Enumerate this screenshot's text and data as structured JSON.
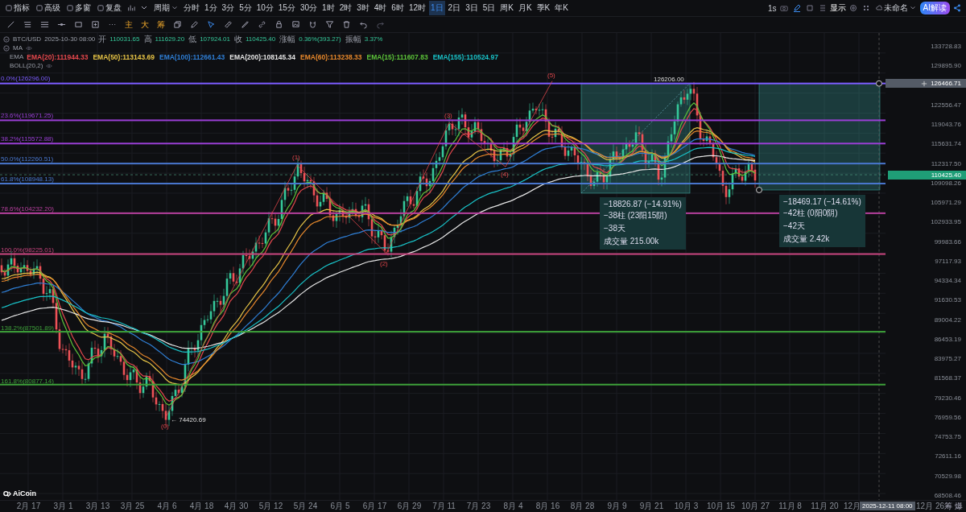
{
  "toolbar": {
    "menus": [
      {
        "label": "指标"
      },
      {
        "label": "高级"
      },
      {
        "label": "多窗"
      },
      {
        "label": "复盘"
      }
    ],
    "period_label": "周期",
    "intervals": [
      {
        "label": "分时",
        "selected": false
      },
      {
        "label": "1分",
        "selected": false
      },
      {
        "label": "3分",
        "selected": false
      },
      {
        "label": "5分",
        "selected": false
      },
      {
        "label": "10分",
        "selected": false
      },
      {
        "label": "15分",
        "selected": false
      },
      {
        "label": "30分",
        "selected": false
      },
      {
        "label": "1时",
        "selected": false
      },
      {
        "label": "2时",
        "selected": false
      },
      {
        "label": "3时",
        "selected": false
      },
      {
        "label": "4时",
        "selected": false
      },
      {
        "label": "6时",
        "selected": false
      },
      {
        "label": "12时",
        "selected": false
      },
      {
        "label": "1日",
        "selected": true
      },
      {
        "label": "2日",
        "selected": false
      },
      {
        "label": "3日",
        "selected": false
      },
      {
        "label": "5日",
        "selected": false
      },
      {
        "label": "周K",
        "selected": false
      },
      {
        "label": "月K",
        "selected": false
      },
      {
        "label": "季K",
        "selected": false
      },
      {
        "label": "年K",
        "selected": false
      }
    ],
    "refresh": "1s",
    "display": "显示",
    "layout_name": "未命名",
    "ai_button": "AI解读"
  },
  "draw_tools": {
    "text_tools": [
      "主",
      "大",
      "筹"
    ]
  },
  "legend": {
    "symbol": "BTC/USD",
    "time": "2025-10-30 08:00",
    "fields": [
      {
        "label": "开",
        "value": "110031.65"
      },
      {
        "label": "高",
        "value": "111629.20"
      },
      {
        "label": "低",
        "value": "107924.01"
      },
      {
        "label": "收",
        "value": "110425.40"
      },
      {
        "label": "涨幅",
        "value": "0.36%(393.27)"
      },
      {
        "label": "振幅",
        "value": "3.37%"
      }
    ],
    "ma": "MA",
    "ema": "EMA",
    "ema_values": [
      {
        "label": "EMA(20):111944.33",
        "color": "#e5484d"
      },
      {
        "label": "EMA(50):113143.69",
        "color": "#e8c547"
      },
      {
        "label": "EMA(100):112661.43",
        "color": "#2f7fd6"
      },
      {
        "label": "EMA(200):108145.34",
        "color": "#e6e6e6"
      },
      {
        "label": "EMA(60):113238.33",
        "color": "#e8892c"
      },
      {
        "label": "EMA(15):111607.83",
        "color": "#5cc33a"
      },
      {
        "label": "EMA(155):110524.97",
        "color": "#19c3c9"
      }
    ],
    "boll": "BOLL(20,2)"
  },
  "fib_levels": [
    {
      "label": "0.0%(126296.00)",
      "color": "#7c5cff"
    },
    {
      "label": "23.6%(119671.25)",
      "color": "#9a3fd6"
    },
    {
      "label": "38.2%(115572.88)",
      "color": "#9a3fd6"
    },
    {
      "label": "50.0%(112260.51)",
      "color": "#4a78d0"
    },
    {
      "label": "61.8%(108948.13)",
      "color": "#4a78d0"
    },
    {
      "label": "78.6%(104232.20)",
      "color": "#b8409f"
    },
    {
      "label": "100.0%(98225.01)",
      "color": "#c8447e"
    },
    {
      "label": "138.2%(87501.89)",
      "color": "#3ea13a"
    },
    {
      "label": "161.8%(80877.14)",
      "color": "#3ea13a"
    }
  ],
  "wave_labels": [
    "(0)",
    "(1)",
    "(2)",
    "(3)",
    "(4)",
    "(5)"
  ],
  "low_label": "← 74420.69",
  "high_label": "126206.00",
  "measurements": [
    {
      "lines": [
        "−18826.87 (−14.91%)",
        "−38柱 (23阳15阴)",
        "−38天",
        "成交量 215.00k"
      ]
    },
    {
      "lines": [
        "−18469.17 (−14.61%)",
        "−42柱 (0阳0阴)",
        "−42天",
        "成交量 2.42k"
      ]
    }
  ],
  "price_axis": {
    "ticks": [
      "133728.83",
      "129895.90",
      "122556.47",
      "119043.76",
      "115631.74",
      "112317.50",
      "109098.26",
      "105971.29",
      "102933.95",
      "99983.66",
      "97117.93",
      "94334.34",
      "91630.53",
      "89004.22",
      "86453.19",
      "83975.27",
      "81568.37",
      "79230.46",
      "76959.56",
      "74753.75",
      "72611.16",
      "70529.98",
      "68508.46"
    ],
    "crosshair_price": "126466.71",
    "last_price": "110425.40"
  },
  "time_axis": {
    "ticks": [
      "2月 17",
      "3月 1",
      "3月 13",
      "3月 25",
      "4月 6",
      "4月 18",
      "4月 30",
      "5月 12",
      "5月 24",
      "6月 5",
      "6月 17",
      "6月 29",
      "7月 11",
      "7月 23",
      "8月 4",
      "8月 16",
      "8月 28",
      "9月 9",
      "9月 21",
      "10月 3",
      "10月 15",
      "10月 27",
      "11月 8",
      "11月 20",
      "12月"
    ],
    "crosshair_time": "2025-12-11 08:00",
    "last_tick": "12月 26",
    "corner": "筹 爆"
  },
  "logo": "AiCoin"
}
